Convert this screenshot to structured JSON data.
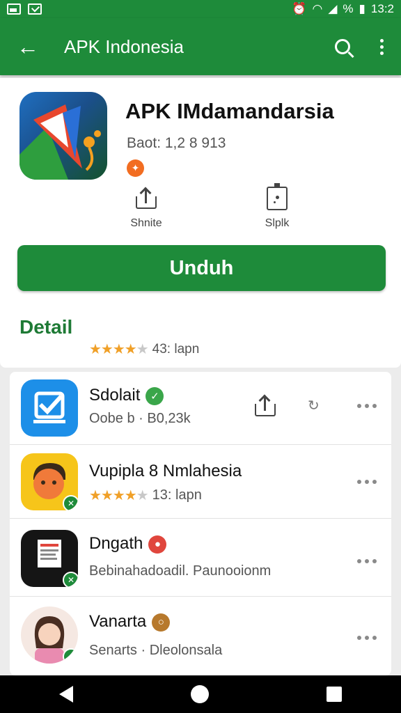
{
  "status_bar": {
    "time": "13:2",
    "battery": "%"
  },
  "app_bar": {
    "title": "APK Indonesia"
  },
  "app": {
    "name": "APK IMdamandarsia",
    "meta": "Baot: 1,2 8 913",
    "badge_icon": "flame-icon"
  },
  "actions": [
    {
      "label": "Shnite",
      "icon": "share-icon"
    },
    {
      "label": "Slplk",
      "icon": "save-icon"
    }
  ],
  "download": {
    "label": "Unduh"
  },
  "detail": {
    "title": "Detail",
    "rating_value": 4,
    "rating_text": "43: lapn"
  },
  "list": [
    {
      "title": "Sdolait",
      "subtitle": "Oobe b  ·  B0,23k",
      "badge_color": "#3aa64a",
      "icon": "checkbox-app-icon"
    },
    {
      "title": "Vupipla 8 Nmlahesia",
      "rating_value": 4,
      "rating_text": "13: lapn",
      "icon": "face-app-icon"
    },
    {
      "title": "Dngath",
      "subtitle": "Bebinahadoadil. Paunooionm",
      "badge_color": "#e0463d",
      "icon": "document-app-icon"
    },
    {
      "title": "Vanarta",
      "subtitle": "Senarts  ·  Dleolonsala",
      "badge_color": "#b7792d",
      "icon": "avatar-app-icon"
    }
  ],
  "colors": {
    "primary": "#1e8b3a",
    "star": "#f0a028"
  }
}
